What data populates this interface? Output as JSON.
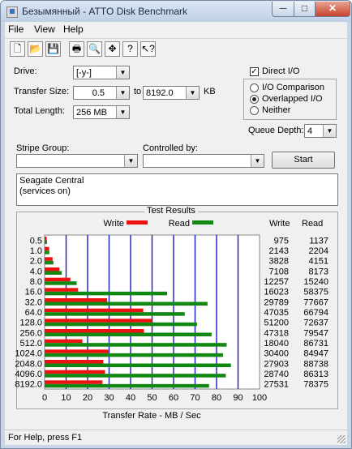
{
  "window": {
    "title": "Безымянный - ATTO Disk Benchmark",
    "min_symbol": "─",
    "max_symbol": "□",
    "close_symbol": "✕"
  },
  "menu": [
    {
      "label": "File"
    },
    {
      "label": "View"
    },
    {
      "label": "Help"
    }
  ],
  "toolbar": [
    {
      "icon": "new-document-icon",
      "glyph": "🗋"
    },
    {
      "icon": "open-folder-icon",
      "glyph": "📂"
    },
    {
      "icon": "save-disk-icon",
      "glyph": "💾"
    },
    {
      "icon": "print-icon",
      "glyph": "🖶"
    },
    {
      "icon": "print-preview-icon",
      "glyph": "🔍"
    },
    {
      "icon": "move-icon",
      "glyph": "✥"
    },
    {
      "icon": "help-icon",
      "glyph": "?"
    },
    {
      "icon": "context-help-icon",
      "glyph": "↖?"
    }
  ],
  "form": {
    "drive_label": "Drive:",
    "drive_value": "[-y-]",
    "transfer_size_label": "Transfer Size:",
    "transfer_from": "0.5",
    "to_label": "to",
    "transfer_to": "8192.0",
    "kb_label": "KB",
    "total_length_label": "Total Length:",
    "total_length_value": "256 MB",
    "direct_io_label": "Direct I/O",
    "direct_io_checked": true,
    "io_comparison_label": "I/O Comparison",
    "overlapped_io_label": "Overlapped I/O",
    "neither_label": "Neither",
    "selected_mode": "Overlapped I/O",
    "queue_depth_label": "Queue Depth:",
    "queue_depth_value": "4",
    "stripe_group_label": "Stripe Group:",
    "stripe_group_value": "",
    "controlled_by_label": "Controlled by:",
    "controlled_by_value": "",
    "start_label": "Start",
    "description_line1": "Seagate Central",
    "description_line2": "(services on)"
  },
  "status": {
    "text": "For Help, press F1"
  },
  "colors": {
    "write": "#ee1111",
    "read": "#118811",
    "gridline": "#1a1ad0"
  },
  "chart_data": {
    "type": "bar",
    "orientation": "horizontal",
    "title": "Test Results",
    "xlabel": "Transfer Rate - MB / Sec",
    "xlim": [
      0,
      100
    ],
    "xticks": [
      0,
      10,
      20,
      30,
      40,
      50,
      60,
      70,
      80,
      90,
      100
    ],
    "categories": [
      "0.5",
      "1.0",
      "2.0",
      "4.0",
      "8.0",
      "16.0",
      "32.0",
      "64.0",
      "128.0",
      "256.0",
      "512.0",
      "1024.0",
      "2048.0",
      "4096.0",
      "8192.0"
    ],
    "legend_position": "top",
    "column_headers": [
      "Write",
      "Read"
    ],
    "series": [
      {
        "name": "Write",
        "values_mb_s": [
          0.95,
          2.1,
          3.7,
          6.9,
          12.0,
          15.6,
          29.1,
          45.9,
          50.0,
          46.2,
          17.6,
          29.7,
          27.3,
          28.1,
          26.9
        ],
        "labels": [
          "975",
          "2143",
          "3828",
          "7108",
          "12257",
          "16023",
          "29789",
          "47035",
          "51200",
          "47318",
          "18040",
          "30400",
          "27903",
          "28740",
          "27531"
        ]
      },
      {
        "name": "Read",
        "values_mb_s": [
          1.1,
          2.2,
          4.1,
          8.0,
          14.9,
          57.0,
          75.8,
          65.2,
          70.9,
          77.7,
          84.7,
          83.0,
          86.7,
          84.3,
          76.5
        ],
        "labels": [
          "1137",
          "2204",
          "4151",
          "8173",
          "15240",
          "58375",
          "77667",
          "66794",
          "72637",
          "79547",
          "86731",
          "84947",
          "88738",
          "86313",
          "78375"
        ]
      }
    ]
  }
}
